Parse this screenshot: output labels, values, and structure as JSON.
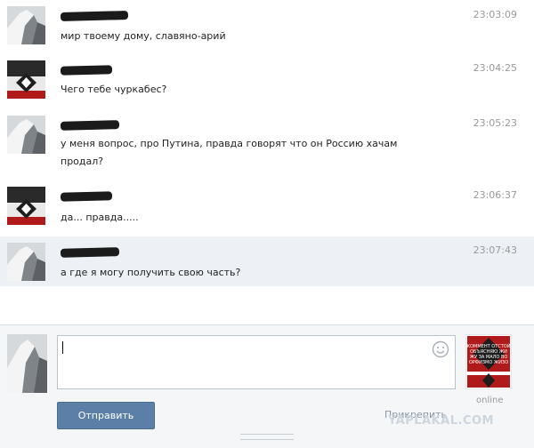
{
  "messages": [
    {
      "text": "мир твоему дому, славяно-арий",
      "time": "23:03:09",
      "avatar": "gray-photo-avatar"
    },
    {
      "text": "Чего тебе чуркабес?",
      "time": "23:04:25",
      "avatar": "red-symbol-avatar"
    },
    {
      "text": "у меня вопрос, про Путина, правда говорят что он Россию хачам\nпродал?",
      "time": "23:05:23",
      "avatar": "gray-photo-avatar"
    },
    {
      "text": "да... правда.....",
      "time": "23:06:37",
      "avatar": "red-symbol-avatar"
    },
    {
      "text": "а где я могу получить свою часть?",
      "time": "23:07:43",
      "avatar": "gray-photo-avatar",
      "highlighted": true
    }
  ],
  "composer": {
    "input_value": "",
    "send_label": "Отправить",
    "attach_label": "Прикрепить",
    "smiley_icon": "smiley-icon"
  },
  "partner": {
    "status": "online",
    "avatar_caption": "КОММЕНТ ОТСТОЙ ОБЪЯСНЯЮ ЖИ ЖУ ЗА МАЛО ВО ОРФИЗМО ЖИЗО"
  },
  "watermark": "YAPLAKAL.COM",
  "colors": {
    "highlight": "#edf1f5",
    "send_button": "#5b7fa6",
    "timestamp": "#9a9a9a",
    "symbol_red": "#b11a1a"
  }
}
